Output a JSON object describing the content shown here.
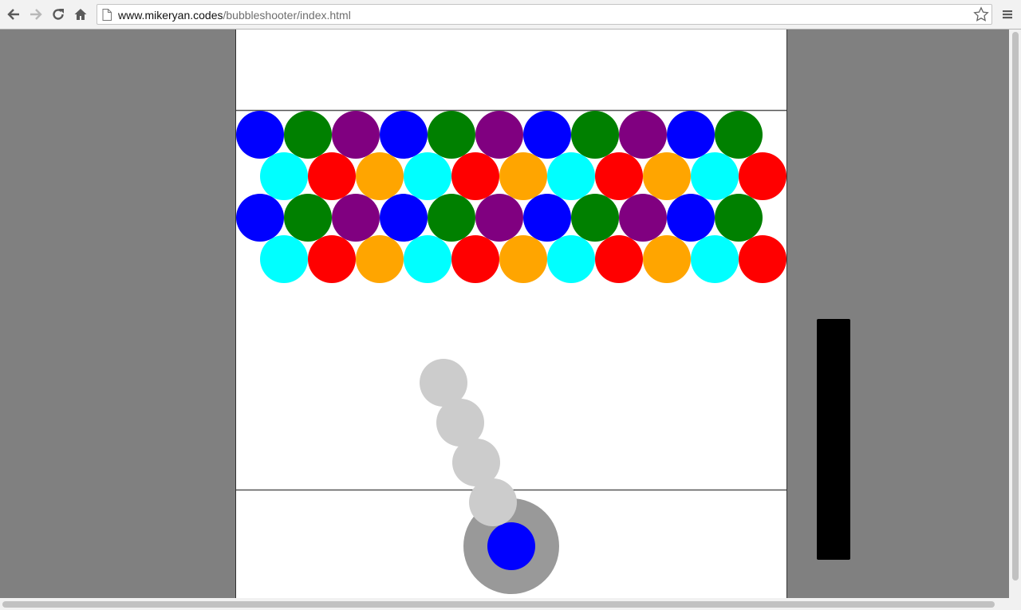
{
  "browser": {
    "url_host": "www.mikeryan.codes",
    "url_path": "/bubbleshooter/index.html",
    "icons": [
      "back-icon",
      "forward-icon",
      "reload-icon",
      "home-icon",
      "page-icon",
      "bookmark-star-icon",
      "menu-icon"
    ]
  },
  "game": {
    "colors": {
      "B": "#0000ff",
      "G": "#008000",
      "P": "#800080",
      "C": "#00ffff",
      "R": "#ff0000",
      "O": "#ffa500"
    },
    "bubble_rows": [
      [
        "B",
        "G",
        "P",
        "B",
        "G",
        "P",
        "B",
        "G",
        "P",
        "B",
        "G"
      ],
      [
        "C",
        "R",
        "O",
        "C",
        "R",
        "O",
        "C",
        "R",
        "O",
        "C",
        "R"
      ],
      [
        "B",
        "G",
        "P",
        "B",
        "G",
        "P",
        "B",
        "G",
        "P",
        "B",
        "G"
      ],
      [
        "C",
        "R",
        "O",
        "C",
        "R",
        "O",
        "C",
        "R",
        "O",
        "C",
        "R"
      ]
    ],
    "aim_trail_dots": 4,
    "aim_trail_color": "#cccccc",
    "launcher_color": "#999999",
    "loaded_bubble_color": "#0000ff",
    "power_meter_color": "#000000"
  }
}
